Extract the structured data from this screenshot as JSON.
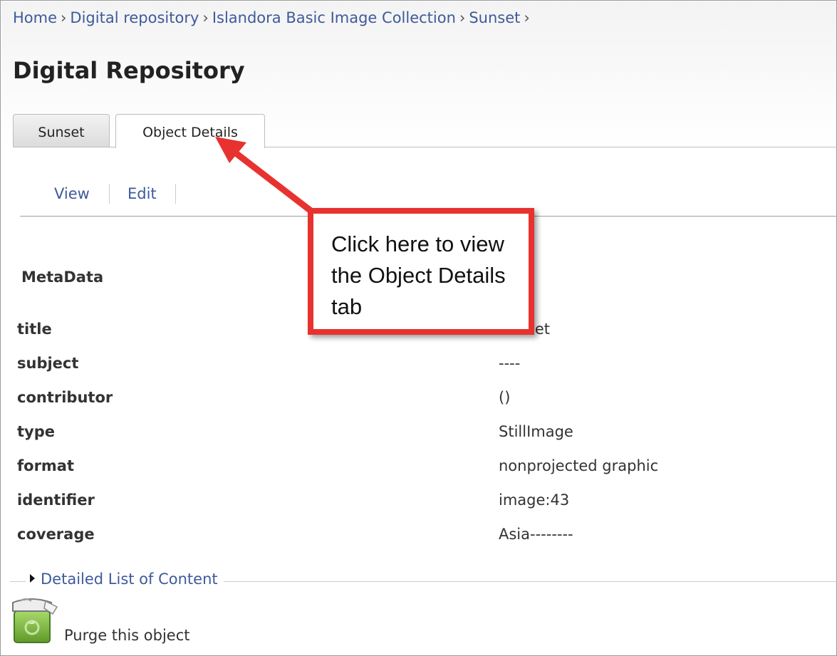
{
  "breadcrumb": {
    "items": [
      "Home",
      "Digital repository",
      "Islandora Basic Image Collection",
      "Sunset"
    ],
    "separator": "›"
  },
  "page_title": "Digital Repository",
  "tabs": [
    {
      "label": "Sunset",
      "active": false
    },
    {
      "label": "Object Details",
      "active": true
    }
  ],
  "subtabs": [
    {
      "label": "View"
    },
    {
      "label": "Edit"
    }
  ],
  "metadata": {
    "heading": "MetaData",
    "rows": [
      {
        "key": "title",
        "value": "Sunset"
      },
      {
        "key": "subject",
        "value": "----"
      },
      {
        "key": "contributor",
        "value": "()"
      },
      {
        "key": "type",
        "value": "StillImage"
      },
      {
        "key": "format",
        "value": "nonprojected graphic"
      },
      {
        "key": "identifier",
        "value": "image:43"
      },
      {
        "key": "coverage",
        "value": "Asia--------"
      }
    ]
  },
  "content_list": {
    "label": "Detailed List of Content"
  },
  "purge": {
    "label": "Purge this object",
    "icon": "trash-bin-icon"
  },
  "callout": {
    "text": "Click here to view the Object Details tab"
  },
  "colors": {
    "link": "#3e5a9b",
    "callout_border": "#e8322f"
  }
}
